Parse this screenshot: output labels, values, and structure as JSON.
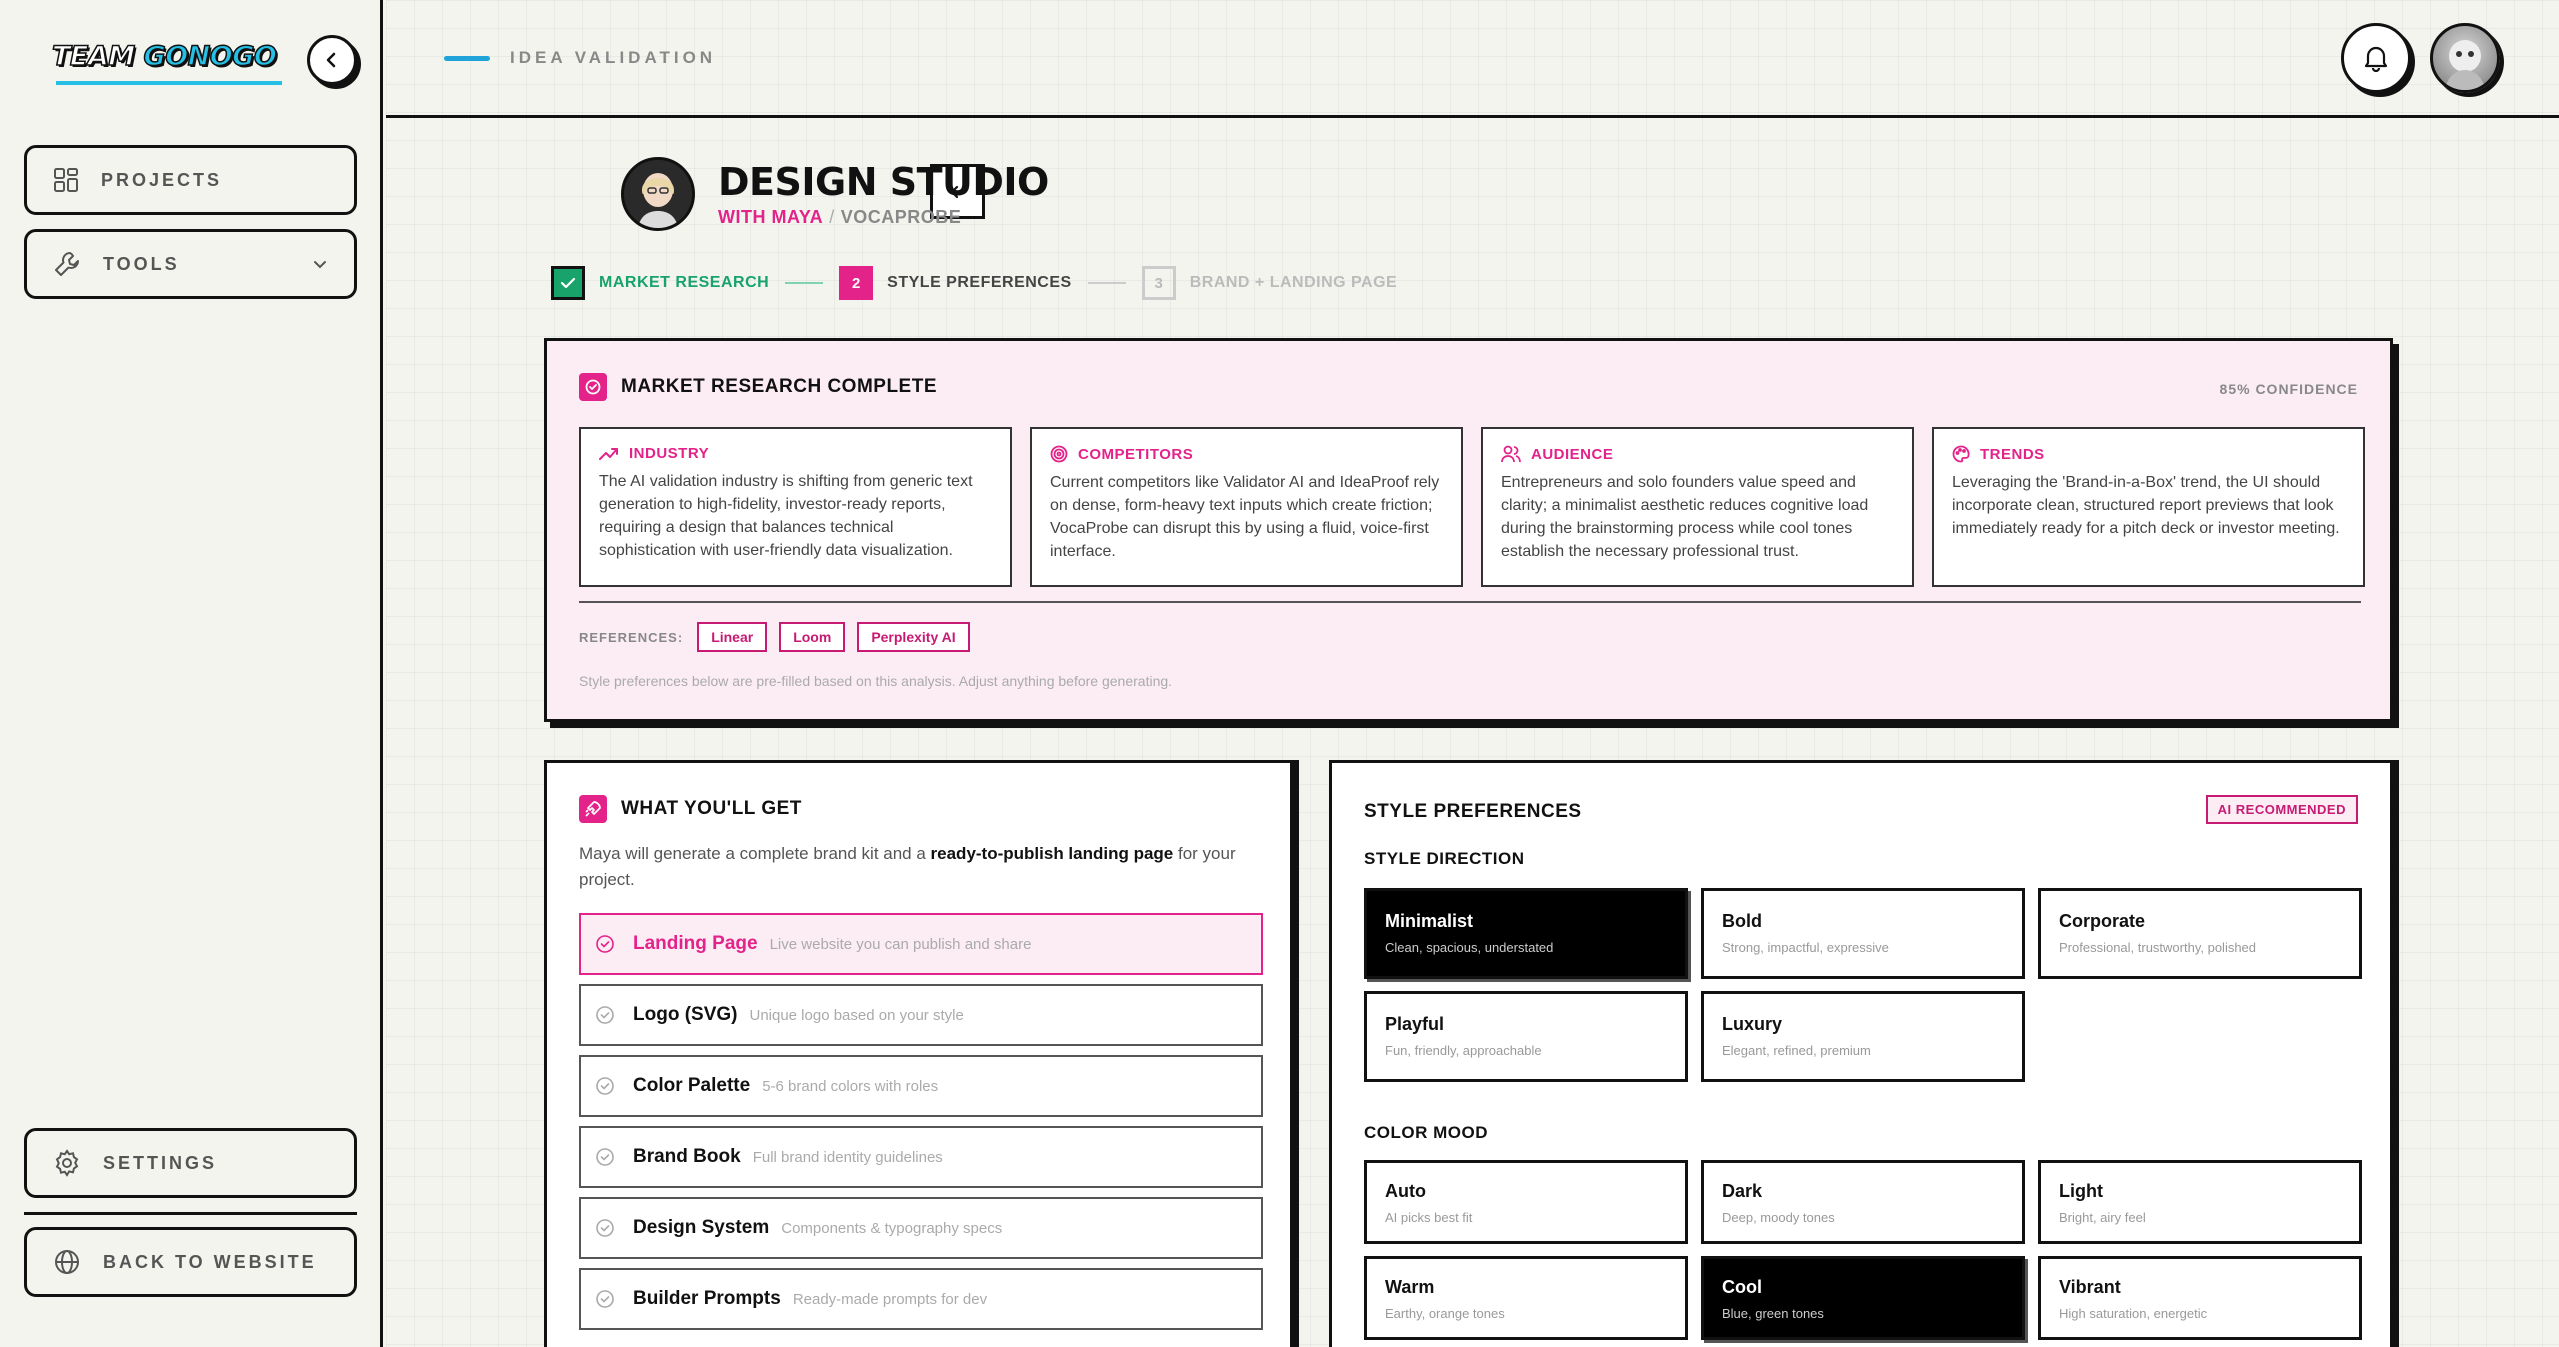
{
  "sidebar": {
    "logo_part1": "TEAM",
    "logo_part2": "GONOGO",
    "nav": [
      {
        "label": "PROJECTS",
        "icon": "grid-icon"
      },
      {
        "label": "TOOLS",
        "icon": "wrench-icon"
      }
    ],
    "bottom": [
      {
        "label": "SETTINGS",
        "icon": "gear-icon"
      },
      {
        "label": "BACK TO WEBSITE",
        "icon": "globe-icon"
      }
    ]
  },
  "topbar": {
    "breadcrumb": "IDEA VALIDATION"
  },
  "studio": {
    "title": "DESIGN STUDIO",
    "with": "WITH MAYA",
    "separator": "/",
    "project": "VOCAPROBE"
  },
  "steps": [
    {
      "label": "MARKET RESEARCH",
      "state": "done",
      "num": ""
    },
    {
      "label": "STYLE PREFERENCES",
      "state": "active",
      "num": "2"
    },
    {
      "label": "BRAND + LANDING PAGE",
      "state": "todo",
      "num": "3"
    }
  ],
  "market_research": {
    "title": "MARKET RESEARCH COMPLETE",
    "confidence": "85% CONFIDENCE",
    "cards": [
      {
        "title": "INDUSTRY",
        "icon": "trending-up-icon",
        "body": "The AI validation industry is shifting from generic text generation to high-fidelity, investor-ready reports, requiring a design that balances technical sophistication with user-friendly data visualization."
      },
      {
        "title": "COMPETITORS",
        "icon": "target-icon",
        "body": "Current competitors like Validator AI and IdeaProof rely on dense, form-heavy text inputs which create friction; VocaProbe can disrupt this by using a fluid, voice-first interface."
      },
      {
        "title": "AUDIENCE",
        "icon": "users-icon",
        "body": "Entrepreneurs and solo founders value speed and clarity; a minimalist aesthetic reduces cognitive load during the brainstorming process while cool tones establish the necessary professional trust."
      },
      {
        "title": "TRENDS",
        "icon": "palette-icon",
        "body": "Leveraging the 'Brand-in-a-Box' trend, the UI should incorporate clean, structured report previews that look immediately ready for a pitch deck or investor meeting."
      }
    ],
    "references_label": "REFERENCES:",
    "references": [
      "Linear",
      "Loom",
      "Perplexity AI"
    ],
    "note": "Style preferences below are pre-filled based on this analysis. Adjust anything before generating."
  },
  "what_youll_get": {
    "title": "WHAT YOU'LL GET",
    "desc_pre": "Maya will generate a complete brand kit and a ",
    "desc_bold": "ready-to-publish landing page",
    "desc_post": " for your project.",
    "items": [
      {
        "name": "Landing Page",
        "desc": "Live website you can publish and share",
        "selected": true
      },
      {
        "name": "Logo (SVG)",
        "desc": "Unique logo based on your style",
        "selected": false
      },
      {
        "name": "Color Palette",
        "desc": "5-6 brand colors with roles",
        "selected": false
      },
      {
        "name": "Brand Book",
        "desc": "Full brand identity guidelines",
        "selected": false
      },
      {
        "name": "Design System",
        "desc": "Components & typography specs",
        "selected": false
      },
      {
        "name": "Builder Prompts",
        "desc": "Ready-made prompts for dev",
        "selected": false
      }
    ]
  },
  "style_preferences": {
    "title": "STYLE PREFERENCES",
    "badge": "AI RECOMMENDED",
    "direction_label": "STYLE DIRECTION",
    "directions": [
      {
        "name": "Minimalist",
        "desc": "Clean, spacious, understated",
        "selected": true
      },
      {
        "name": "Bold",
        "desc": "Strong, impactful, expressive",
        "selected": false
      },
      {
        "name": "Corporate",
        "desc": "Professional, trustworthy, polished",
        "selected": false
      },
      {
        "name": "Playful",
        "desc": "Fun, friendly, approachable",
        "selected": false
      },
      {
        "name": "Luxury",
        "desc": "Elegant, refined, premium",
        "selected": false
      }
    ],
    "color_mood_label": "COLOR MOOD",
    "moods": [
      {
        "name": "Auto",
        "desc": "AI picks best fit",
        "selected": false
      },
      {
        "name": "Dark",
        "desc": "Deep, moody tones",
        "selected": false
      },
      {
        "name": "Light",
        "desc": "Bright, airy feel",
        "selected": false
      },
      {
        "name": "Warm",
        "desc": "Earthy, orange tones",
        "selected": false
      },
      {
        "name": "Cool",
        "desc": "Blue, green tones",
        "selected": true
      },
      {
        "name": "Vibrant",
        "desc": "High saturation, energetic",
        "selected": false
      }
    ]
  },
  "colors": {
    "accent_pink": "#e3228a",
    "success_green": "#18a36a",
    "brand_cyan": "#26c0e6",
    "ink": "#111111"
  }
}
